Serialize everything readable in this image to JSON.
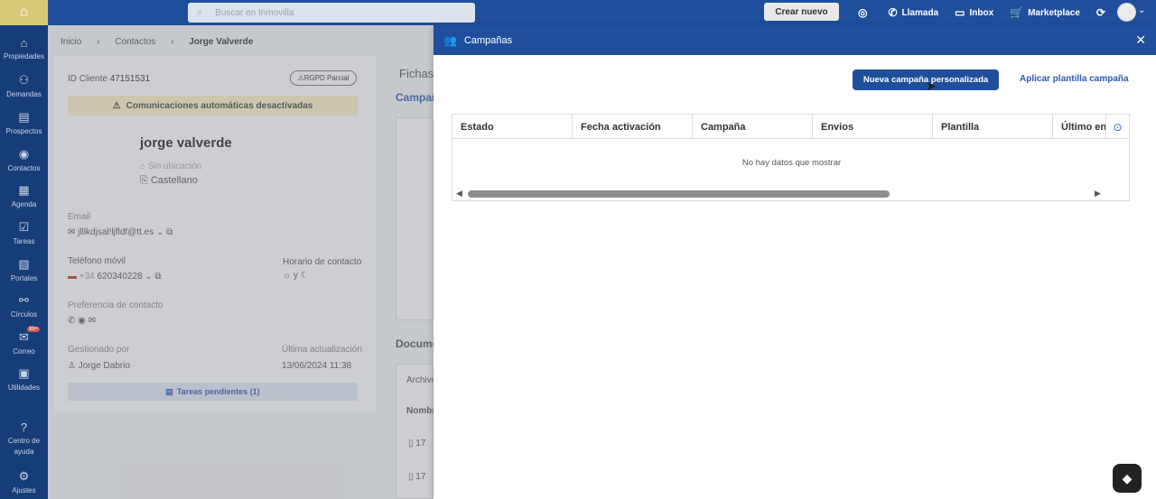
{
  "topbar": {
    "search_placeholder": "Buscar en Inmovilla",
    "create_button": "Crear nuevo",
    "actions": [
      {
        "icon": "eye-off-icon",
        "label": ""
      },
      {
        "icon": "phone-icon",
        "label": "Llamada"
      },
      {
        "icon": "inbox-icon",
        "label": "Inbox"
      },
      {
        "icon": "cart-icon",
        "label": "Marketplace"
      },
      {
        "icon": "refresh-icon",
        "label": ""
      }
    ]
  },
  "sidebar": {
    "items": [
      {
        "label": "Propiedades",
        "icon": "home-icon"
      },
      {
        "label": "Demandas",
        "icon": "demands-icon"
      },
      {
        "label": "Prospectos",
        "icon": "list-icon"
      },
      {
        "label": "Contactos",
        "icon": "user-circle-icon"
      },
      {
        "label": "Agenda",
        "icon": "calendar-icon"
      },
      {
        "label": "Tareas",
        "icon": "tasks-icon"
      },
      {
        "label": "Portales",
        "icon": "portals-icon"
      },
      {
        "label": "Círculos",
        "icon": "circles-icon"
      },
      {
        "label": "Correo",
        "icon": "mail-icon",
        "badge": "99+"
      },
      {
        "label": "Utilidades",
        "icon": "tools-icon"
      },
      {
        "label": "Centro de ayuda",
        "icon": "help-icon"
      },
      {
        "label": "Ajustes",
        "icon": "gear-icon"
      }
    ]
  },
  "breadcrumb": {
    "items": [
      "Inicio",
      "Contactos"
    ],
    "current": "Jorge Valverde"
  },
  "contact": {
    "id_label": "ID Cliente",
    "id_value": "47151531",
    "rgpd": "RGPD Parcial",
    "warning": "Comunicaciones automáticas desactivadas",
    "name": "jorge valverde",
    "nationality": "Sin ubicación",
    "language": "Castellano",
    "email_label": "Email",
    "email_value": "jlllkdjsal!ljfldf@tt.es",
    "phone_label": "Teléfono móvil",
    "phone_prefix": "+34",
    "phone_value": "620340228",
    "schedule_label": "Horario de contacto",
    "schedule_value": "y",
    "preference_label": "Preferencia de contacto",
    "managed_label": "Gestionado por",
    "managed_value": "Jorge Dabrio",
    "updated_label": "Última actualización",
    "updated_value": "13/06/2024 11:38",
    "tasks": "Tareas pendientes (1)"
  },
  "middle": {
    "fichas": "Fichas",
    "campa": "Campañ",
    "docs": "Docume",
    "archivos": "Archivo",
    "nombre": "Nombr",
    "row1": "17",
    "row2": "17"
  },
  "panel": {
    "title": "Campañas",
    "new_button": "Nueva campaña personalizada",
    "apply_link": "Aplicar plantilla campaña",
    "columns": [
      "Estado",
      "Fecha activación",
      "Campaña",
      "Envios",
      "Plantilla",
      "Último env"
    ],
    "empty_message": "No hay datos que mostrar",
    "scroll_position": 0.0
  }
}
